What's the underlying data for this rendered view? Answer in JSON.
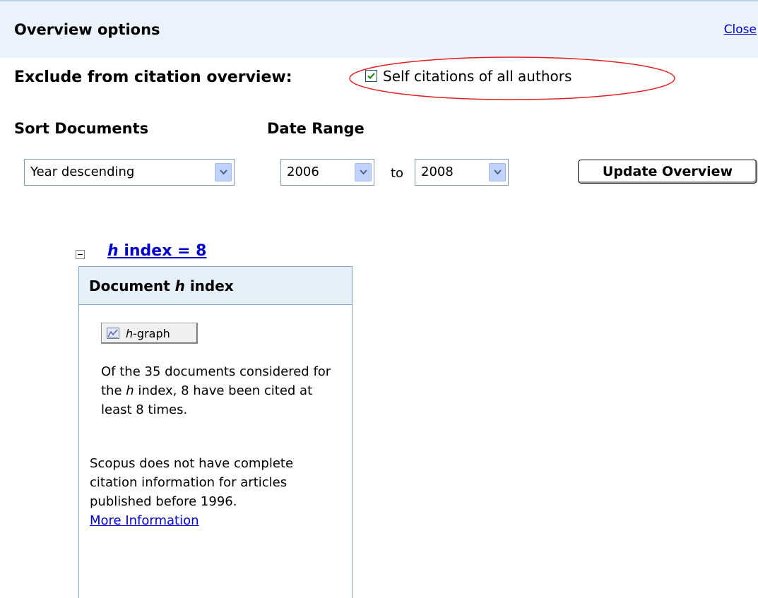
{
  "header": {
    "title": "Overview options",
    "close_label": "Close"
  },
  "exclude": {
    "label": "Exclude from citation overview:",
    "checkbox_label": "Self citations of all authors",
    "checked": true
  },
  "sort": {
    "label": "Sort Documents",
    "value": "Year descending"
  },
  "date_range": {
    "label": "Date Range",
    "from": "2006",
    "to_label": "to",
    "to": "2008"
  },
  "update_button": "Update Overview",
  "hindex": {
    "link_italic": "h",
    "link_rest": " index = 8",
    "box_title_pre": "Document ",
    "box_title_italic": "h",
    "box_title_post": " index",
    "graph_button_italic": "h",
    "graph_button_rest": "-graph",
    "summary_pre": "Of the 35 documents considered for the ",
    "summary_italic": "h",
    "summary_post": " index, 8 have been cited at least 8 times.",
    "note": "Scopus does not have complete citation information for articles published before 1996.",
    "more_info": "More Information"
  },
  "colors": {
    "header_bg": "#eaf3fb",
    "link": "#0000cc",
    "ellipse": "#e02020",
    "checkmark": "#1e8c1e"
  }
}
